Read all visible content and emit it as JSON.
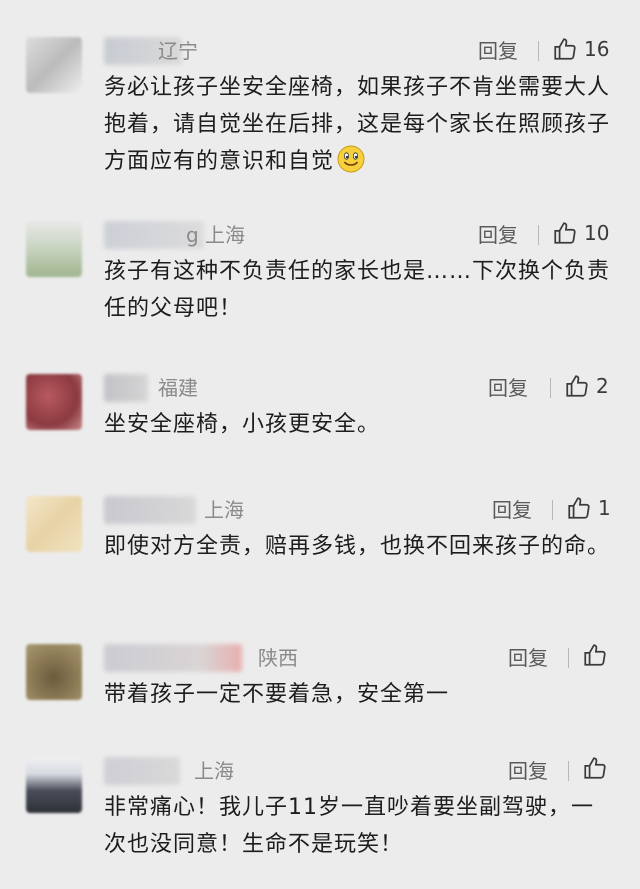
{
  "comments": [
    {
      "location": "辽宁",
      "reply_label": "回复",
      "likes": "16",
      "text": "务必让孩子坐安全座椅，如果孩子不肯坐需要大人抱着，请自觉坐在后排，这是每个家长在照顾孩子方面应有的意识和自觉",
      "has_emoji": true
    },
    {
      "location": "g 上海",
      "reply_label": "回复",
      "likes": "10",
      "text": "孩子有这种不负责任的家长也是……下次换个负责任的父母吧！"
    },
    {
      "location": "福建",
      "reply_label": "回复",
      "likes": "2",
      "text": "坐安全座椅，小孩更安全。"
    },
    {
      "location": "上海",
      "reply_label": "回复",
      "likes": "1",
      "text": "即使对方全责，赔再多钱，也换不回来孩子的命。"
    },
    {
      "location": "陕西",
      "reply_label": "回复",
      "likes": "",
      "text": "带着孩子一定不要着急，安全第一"
    },
    {
      "location": "上海",
      "reply_label": "回复",
      "likes": "",
      "text": "非常痛心！我儿子11岁一直吵着要坐副驾驶，一次也没同意！生命不是玩笑！"
    }
  ],
  "icons": {
    "like": "thumbs-up-icon",
    "emoji": "smile-emoji-icon"
  },
  "colors": {
    "background": "#ececec",
    "text": "#1d1d1d",
    "meta": "#8a8a8a"
  }
}
